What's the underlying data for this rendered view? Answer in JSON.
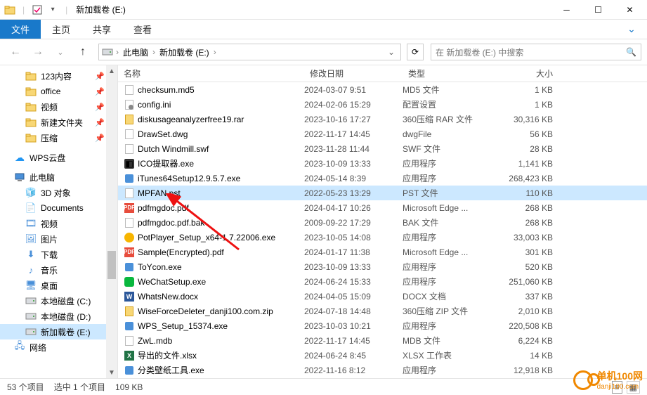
{
  "window": {
    "title": "新加载卷 (E:)",
    "sep": "|"
  },
  "ribbon": {
    "file": "文件",
    "tabs": [
      "主页",
      "共享",
      "查看"
    ]
  },
  "breadcrumb": {
    "segments": [
      "此电脑",
      "新加载卷 (E:)"
    ],
    "sep": "›"
  },
  "search": {
    "placeholder": "在 新加载卷 (E:) 中搜索"
  },
  "tree": {
    "items": [
      {
        "label": "123内容",
        "depth": 1,
        "icon": "folder",
        "pin": true
      },
      {
        "label": "office",
        "depth": 1,
        "icon": "folder",
        "pin": true
      },
      {
        "label": "视频",
        "depth": 1,
        "icon": "folder",
        "pin": true
      },
      {
        "label": "新建文件夹",
        "depth": 1,
        "icon": "folder",
        "pin": true
      },
      {
        "label": "压缩",
        "depth": 1,
        "icon": "folder",
        "pin": true
      },
      {
        "label": "WPS云盘",
        "depth": 0,
        "icon": "wps"
      },
      {
        "label": "此电脑",
        "depth": 0,
        "icon": "pc"
      },
      {
        "label": "3D 对象",
        "depth": 1,
        "icon": "3d"
      },
      {
        "label": "Documents",
        "depth": 1,
        "icon": "docs"
      },
      {
        "label": "视频",
        "depth": 1,
        "icon": "video"
      },
      {
        "label": "图片",
        "depth": 1,
        "icon": "pics"
      },
      {
        "label": "下载",
        "depth": 1,
        "icon": "dl"
      },
      {
        "label": "音乐",
        "depth": 1,
        "icon": "music"
      },
      {
        "label": "桌面",
        "depth": 1,
        "icon": "desktop"
      },
      {
        "label": "本地磁盘 (C:)",
        "depth": 1,
        "icon": "drive"
      },
      {
        "label": "本地磁盘 (D:)",
        "depth": 1,
        "icon": "drive"
      },
      {
        "label": "新加载卷 (E:)",
        "depth": 1,
        "icon": "drive",
        "selected": true
      },
      {
        "label": "网络",
        "depth": 0,
        "icon": "net"
      }
    ]
  },
  "columns": {
    "name": "名称",
    "date": "修改日期",
    "type": "类型",
    "size": "大小"
  },
  "files": [
    {
      "name": "checksum.md5",
      "date": "2024-03-07 9:51",
      "type": "MD5 文件",
      "size": "1 KB",
      "ico": "doc"
    },
    {
      "name": "config.ini",
      "date": "2024-02-06 15:29",
      "type": "配置设置",
      "size": "1 KB",
      "ico": "ini"
    },
    {
      "name": "diskusageanalyzerfree19.rar",
      "date": "2023-10-16 17:27",
      "type": "360压缩 RAR 文件",
      "size": "30,316 KB",
      "ico": "zip"
    },
    {
      "name": "DrawSet.dwg",
      "date": "2022-11-17 14:45",
      "type": "dwgFile",
      "size": "56 KB",
      "ico": "dwg"
    },
    {
      "name": "Dutch Windmill.swf",
      "date": "2023-11-28 11:44",
      "type": "SWF 文件",
      "size": "28 KB",
      "ico": "swf"
    },
    {
      "name": "ICO提取器.exe",
      "date": "2023-10-09 13:33",
      "type": "应用程序",
      "size": "1,141 KB",
      "ico": "ico"
    },
    {
      "name": "iTunes64Setup12.9.5.7.exe",
      "date": "2024-05-14 8:39",
      "type": "应用程序",
      "size": "268,423 KB",
      "ico": "exe"
    },
    {
      "name": "MPFAN.pst",
      "date": "2022-05-23 13:29",
      "type": "PST 文件",
      "size": "110 KB",
      "ico": "doc",
      "selected": true
    },
    {
      "name": "pdfmgdoc.pdf",
      "date": "2024-04-17 10:26",
      "type": "Microsoft Edge ...",
      "size": "268 KB",
      "ico": "pdf"
    },
    {
      "name": "pdfmgdoc.pdf.bak",
      "date": "2009-09-22 17:29",
      "type": "BAK 文件",
      "size": "268 KB",
      "ico": "doc"
    },
    {
      "name": "PotPlayer_Setup_x64-1.7.22006.exe",
      "date": "2023-10-05 14:08",
      "type": "应用程序",
      "size": "33,003 KB",
      "ico": "pot"
    },
    {
      "name": "Sample(Encrypted).pdf",
      "date": "2024-01-17 11:38",
      "type": "Microsoft Edge ...",
      "size": "301 KB",
      "ico": "pdf"
    },
    {
      "name": "ToYcon.exe",
      "date": "2023-10-09 13:33",
      "type": "应用程序",
      "size": "520 KB",
      "ico": "exe"
    },
    {
      "name": "WeChatSetup.exe",
      "date": "2024-06-24 15:33",
      "type": "应用程序",
      "size": "251,060 KB",
      "ico": "wechat"
    },
    {
      "name": "WhatsNew.docx",
      "date": "2024-04-05 15:09",
      "type": "DOCX 文档",
      "size": "337 KB",
      "ico": "word"
    },
    {
      "name": "WiseForceDeleter_danji100.com.zip",
      "date": "2024-07-18 14:48",
      "type": "360压缩 ZIP 文件",
      "size": "2,010 KB",
      "ico": "zip"
    },
    {
      "name": "WPS_Setup_15374.exe",
      "date": "2023-10-03 10:21",
      "type": "应用程序",
      "size": "220,508 KB",
      "ico": "exe"
    },
    {
      "name": "ZwL.mdb",
      "date": "2022-11-17 14:45",
      "type": "MDB 文件",
      "size": "6,224 KB",
      "ico": "doc"
    },
    {
      "name": "导出的文件.xlsx",
      "date": "2024-06-24 8:45",
      "type": "XLSX 工作表",
      "size": "14 KB",
      "ico": "xls"
    },
    {
      "name": "分类壁纸工具.exe",
      "date": "2022-11-16 8:12",
      "type": "应用程序",
      "size": "12,918 KB",
      "ico": "exe"
    }
  ],
  "status": {
    "count": "53 个项目",
    "selection": "选中 1 个项目",
    "sel_size": "109 KB"
  },
  "watermark": {
    "name": "单机100网",
    "url": "danji100.com"
  }
}
